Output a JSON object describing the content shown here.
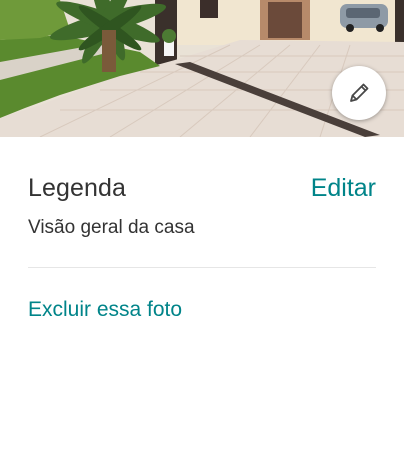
{
  "photo": {
    "description_icon": "house-photo",
    "edit_button_icon": "pencil-icon"
  },
  "caption": {
    "title": "Legenda",
    "edit_label": "Editar",
    "text": "Visão geral da casa"
  },
  "actions": {
    "delete_label": "Excluir essa foto"
  },
  "colors": {
    "accent": "#008489",
    "text": "#333333",
    "divider": "#e6e6e6"
  }
}
